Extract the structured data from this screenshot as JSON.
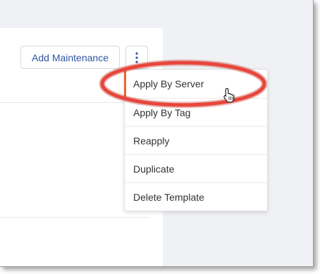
{
  "toolbar": {
    "add_maintenance_label": "Add Maintenance"
  },
  "dropdown_menu": {
    "items": [
      {
        "label": "Apply By Server",
        "active": true
      },
      {
        "label": "Apply By Tag"
      },
      {
        "label": "Reapply"
      },
      {
        "label": "Duplicate"
      },
      {
        "label": "Delete Template"
      }
    ]
  },
  "annotation": {
    "color": "#e8463c"
  },
  "colors": {
    "accent": "#e8692f",
    "button_text": "#2f55a4",
    "background": "#f0f1f4"
  }
}
